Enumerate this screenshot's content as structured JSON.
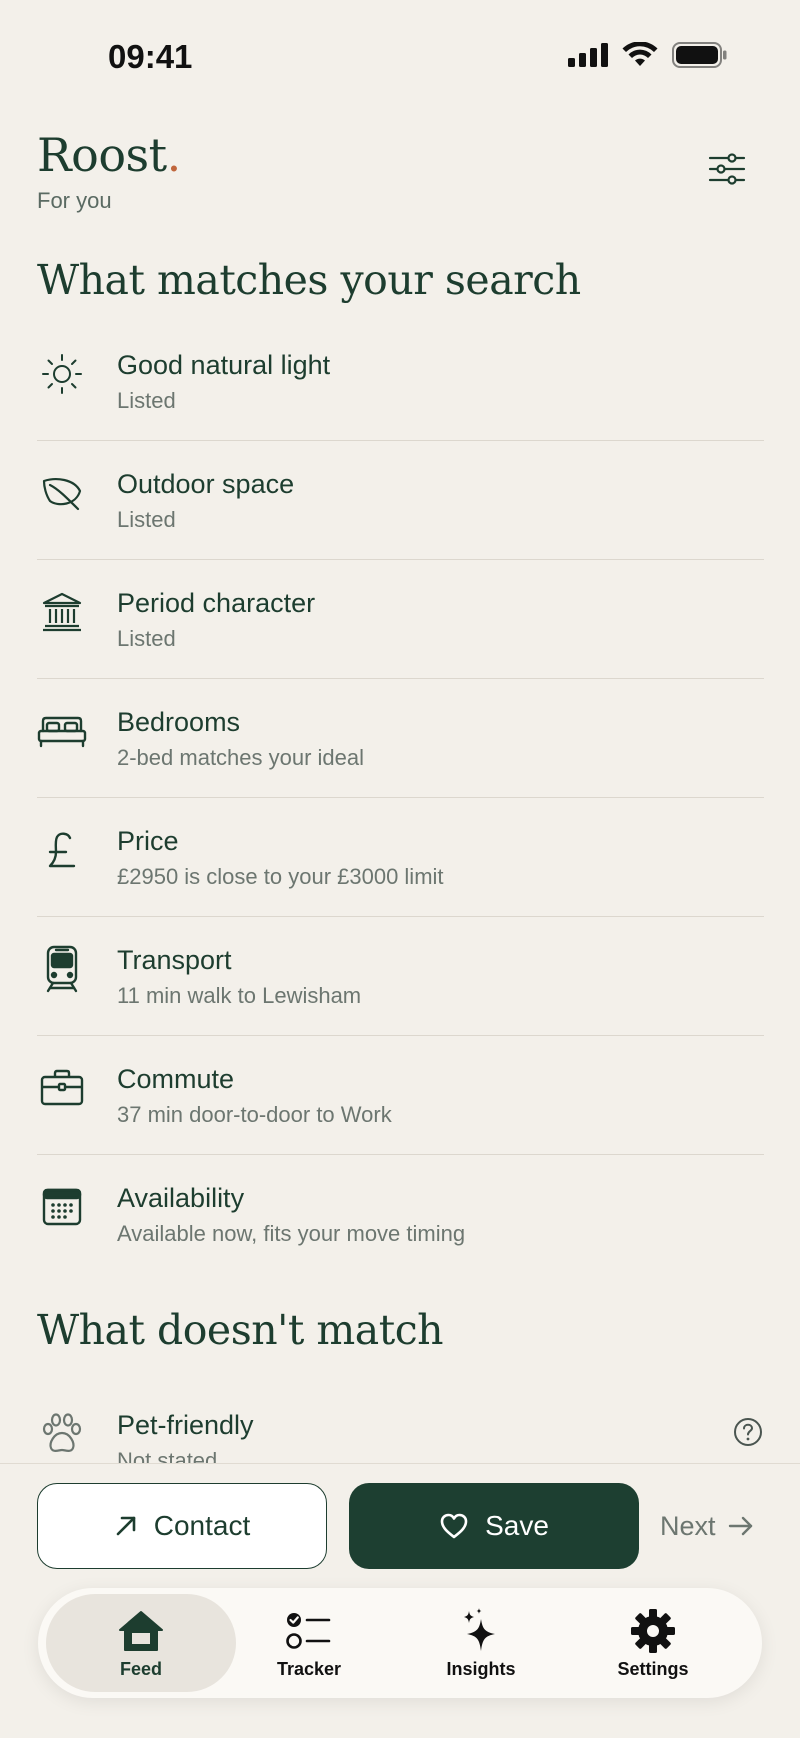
{
  "status_bar": {
    "time": "09:41"
  },
  "header": {
    "brand": "Roost",
    "brand_dot": ".",
    "subtitle": "For you"
  },
  "matches_section": {
    "title": "What matches your search",
    "items": [
      {
        "icon": "sun-icon",
        "title": "Good natural light",
        "detail": "Listed"
      },
      {
        "icon": "leaf-icon",
        "title": "Outdoor space",
        "detail": "Listed"
      },
      {
        "icon": "building-columns-icon",
        "title": "Period character",
        "detail": "Listed"
      },
      {
        "icon": "bed-icon",
        "title": "Bedrooms",
        "detail": "2-bed matches your ideal"
      },
      {
        "icon": "pound-icon",
        "title": "Price",
        "detail": "£2950 is close to your £3000 limit"
      },
      {
        "icon": "train-icon",
        "title": "Transport",
        "detail": "11 min walk to Lewisham"
      },
      {
        "icon": "briefcase-icon",
        "title": "Commute",
        "detail": "37 min door-to-door to Work"
      },
      {
        "icon": "calendar-icon",
        "title": "Availability",
        "detail": "Available now, fits your move timing"
      }
    ]
  },
  "mismatch_section": {
    "title": "What doesn't match",
    "items": [
      {
        "icon": "paw-icon",
        "title": "Pet-friendly",
        "detail": "Not stated"
      }
    ]
  },
  "actions": {
    "contact_label": "Contact",
    "save_label": "Save",
    "next_label": "Next"
  },
  "tabs": [
    {
      "label": "Feed",
      "icon": "home-icon",
      "active": true
    },
    {
      "label": "Tracker",
      "icon": "checklist-icon",
      "active": false
    },
    {
      "label": "Insights",
      "icon": "sparkle-icon",
      "active": false
    },
    {
      "label": "Settings",
      "icon": "gear-icon",
      "active": false
    }
  ],
  "colors": {
    "background": "#F3F0EA",
    "primary": "#1D3F31",
    "accent_dot": "#C0663C",
    "muted_text": "#6C7670"
  }
}
